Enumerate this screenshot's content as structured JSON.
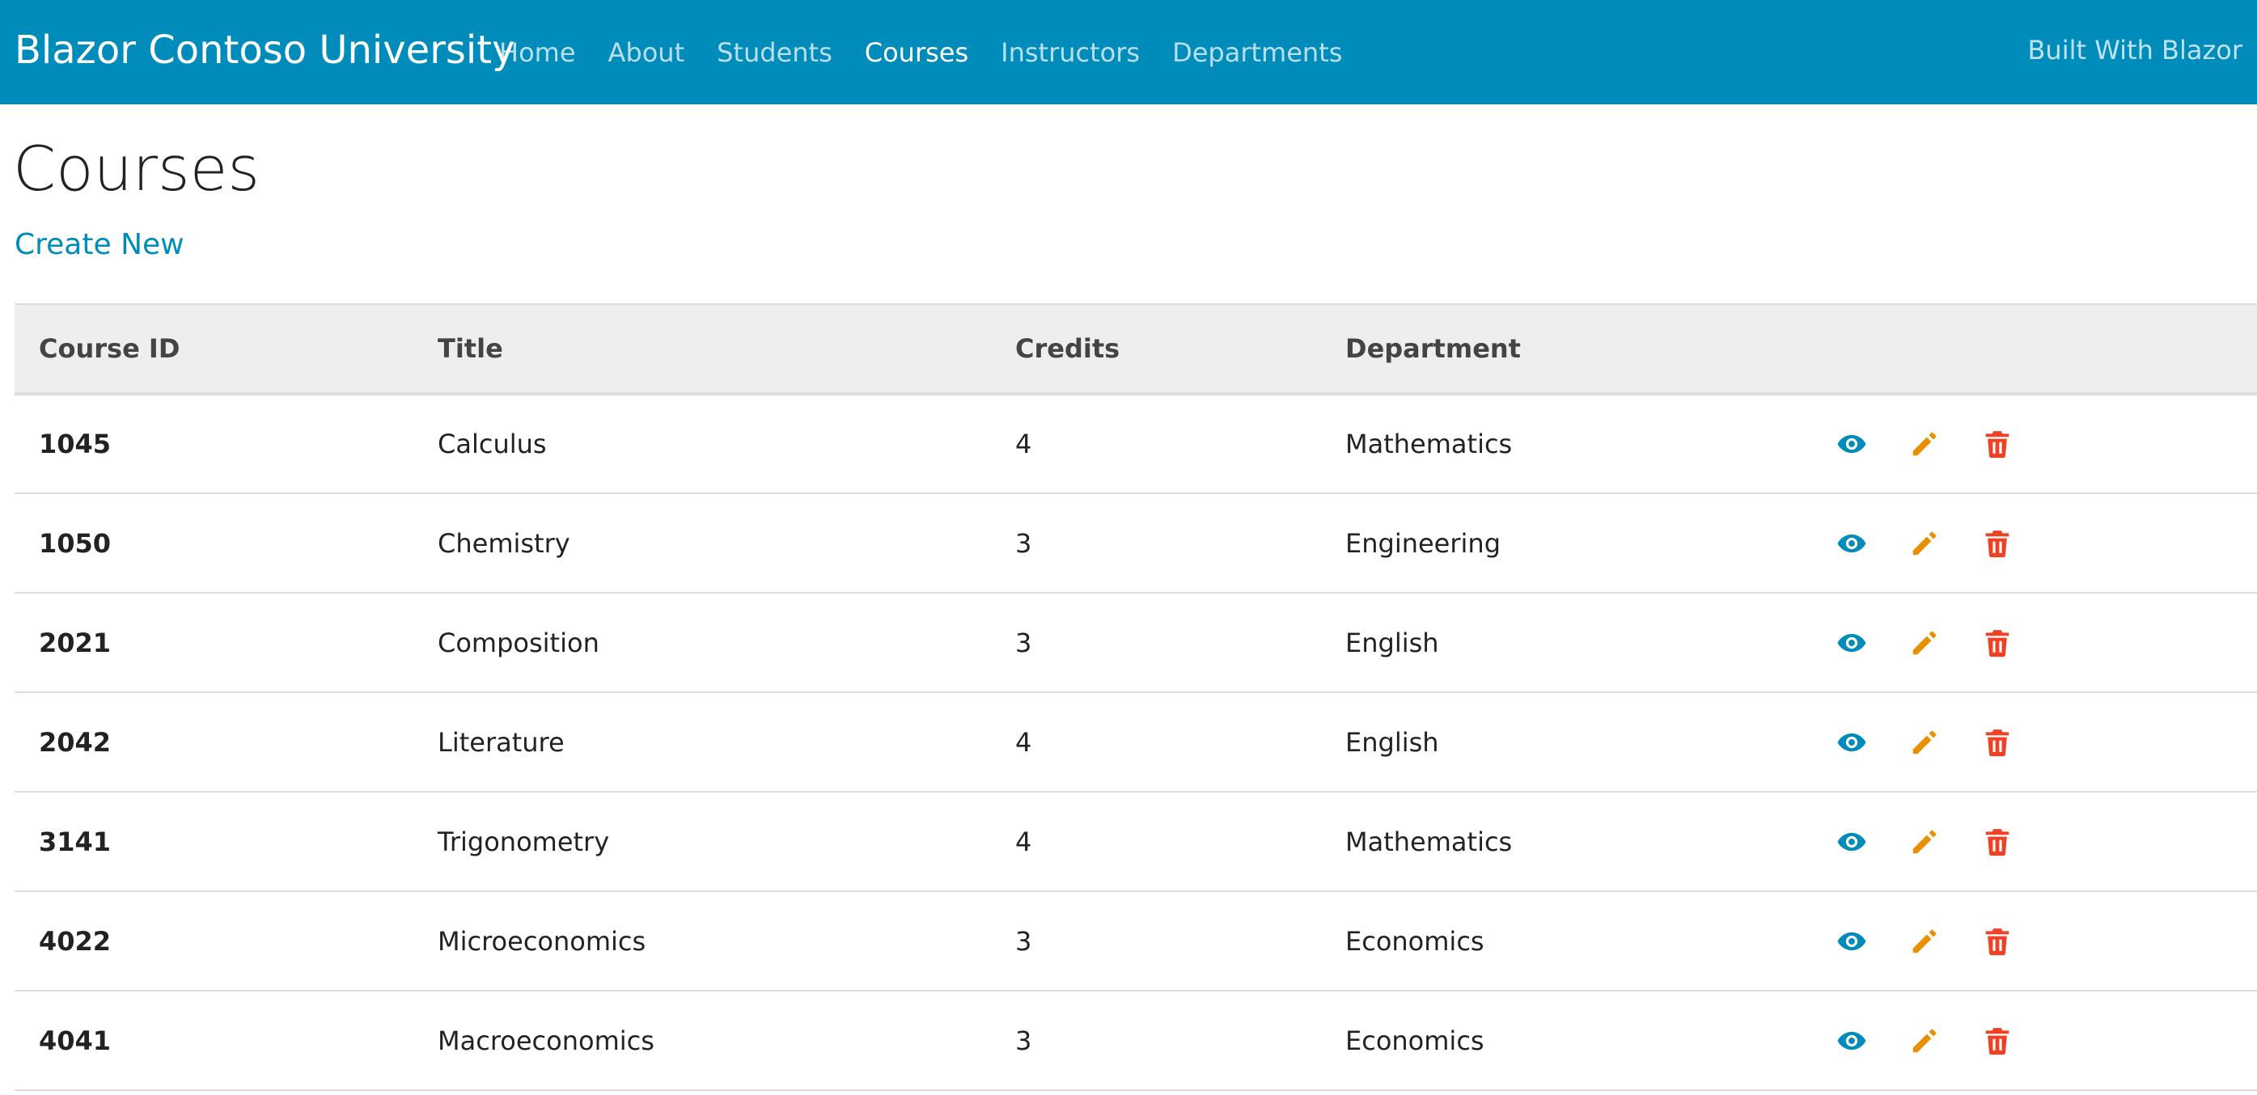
{
  "navbar": {
    "brand": "Blazor Contoso University",
    "links": [
      {
        "label": "Home"
      },
      {
        "label": "About"
      },
      {
        "label": "Students"
      },
      {
        "label": "Courses"
      },
      {
        "label": "Instructors"
      },
      {
        "label": "Departments"
      }
    ],
    "active_link": "Courses",
    "right_link": "Built With Blazor",
    "background_color": "#008cba"
  },
  "page": {
    "title": "Courses",
    "create_new_label": "Create New"
  },
  "table": {
    "headers": [
      "Course ID",
      "Title",
      "Credits",
      "Department",
      ""
    ],
    "rows": [
      {
        "course_id": "1045",
        "title": "Calculus",
        "credits": "4",
        "department": "Mathematics"
      },
      {
        "course_id": "1050",
        "title": "Chemistry",
        "credits": "3",
        "department": "Engineering"
      },
      {
        "course_id": "2021",
        "title": "Composition",
        "credits": "3",
        "department": "English"
      },
      {
        "course_id": "2042",
        "title": "Literature",
        "credits": "4",
        "department": "English"
      },
      {
        "course_id": "3141",
        "title": "Trigonometry",
        "credits": "4",
        "department": "Mathematics"
      },
      {
        "course_id": "4022",
        "title": "Microeconomics",
        "credits": "3",
        "department": "Economics"
      },
      {
        "course_id": "4041",
        "title": "Macroeconomics",
        "credits": "3",
        "department": "Economics"
      }
    ],
    "row_actions": [
      {
        "icon": "eye-icon",
        "action": "details",
        "color": "#008cba"
      },
      {
        "icon": "pencil-icon",
        "action": "edit",
        "color": "#e99002"
      },
      {
        "icon": "trash-icon",
        "action": "delete",
        "color": "#f04124"
      }
    ]
  }
}
